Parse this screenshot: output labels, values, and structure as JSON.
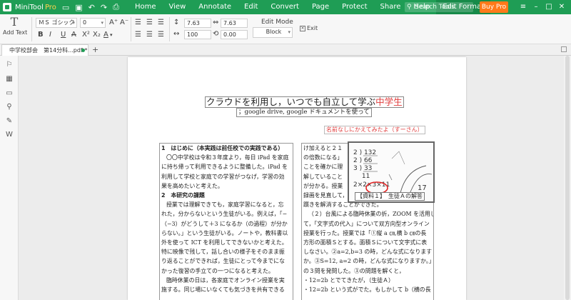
{
  "app": {
    "name": "MiniTool",
    "edition": "Pro",
    "menu": [
      "Home",
      "View",
      "Annotate",
      "Edit",
      "Convert",
      "Page",
      "Protect",
      "Share",
      "Help",
      "Edit Format"
    ],
    "search_placeholder": "Search Tools",
    "buy_label": "Buy Pro",
    "accent_color": "#1f9d55",
    "buy_color": "#ff7a1a"
  },
  "toolbar": {
    "add_text_label": "Add Text",
    "add_text_icon": "T",
    "font_family": "ＭＳ ゴシック",
    "font_size": "0",
    "style_buttons": [
      "B",
      "I",
      "U",
      "A",
      "X²",
      "X₂",
      "A"
    ],
    "line_spacing": "7.63",
    "char_spacing": "7.63",
    "scale": "100",
    "rotation": "0.00",
    "edit_mode_label": "Edit Mode",
    "edit_mode_value": "Block",
    "exit_label": "Exit"
  },
  "tabs": {
    "doc_tab_label": "中学校部会　第14分科...pdf *",
    "add_tab": "+"
  },
  "document": {
    "title_main": "クラウドを利用し，いつでも自立して学ぶ",
    "title_highlight": "中学生",
    "subtitle": "；google drive, google ドキュメントを使って",
    "author": "名前なしにかえてみたよ（すーさん）",
    "left_column": [
      {
        "t": "1　はじめに（本実践は前任校での実践である）",
        "h": true
      },
      {
        "t": "〇〇中学校は令和３年度より，毎日 iPad を家庭",
        "ind": true
      },
      {
        "t": "に持ち帰って利用できるように整備した。iPad を"
      },
      {
        "t": "利用して学校と家庭での学習がつなげ，学習の効"
      },
      {
        "t": "果を高めたいと考えた。"
      },
      {
        "t": "2　本研究の課題",
        "h": true
      },
      {
        "t": "授業では理解できても，家庭学習になると，忘",
        "ind": true
      },
      {
        "t": "れた，分からないという生徒がいる。例えば，「−"
      },
      {
        "t": "（−3）がどうして＋3 になるか（の過程）が分か"
      },
      {
        "t": "らない。」という生徒がいる。ノートや，教科書以"
      },
      {
        "t": "外を使って ICT を利用してできないかと考えた。"
      },
      {
        "t": "特に映像で残して，話し合いの様子をそのまま振"
      },
      {
        "t": "り返ることができれば，生徒にとって今までにな"
      },
      {
        "t": "かった復習の手立ての一つになると考えた。"
      },
      {
        "t": "臨時休業の日は，各家庭でオンライン授業を実",
        "ind": true
      },
      {
        "t": "施する。同じ場にいなくても気づきを共有できる"
      }
    ],
    "right_column": [
      {
        "t": "け加えると２１"
      },
      {
        "t": "の倍数になる」"
      },
      {
        "t": "ことを確かに理"
      },
      {
        "t": "解していること"
      },
      {
        "t": "が分かる。授業"
      },
      {
        "t": "録画を見直して，"
      },
      {
        "t": "躓きを解消することができた。"
      },
      {
        "t": "（２）台風による臨時休業の折，ZOOM を活用し",
        "ind": true
      },
      {
        "t": "て，「文字式の代入」について双方向型オンライン"
      },
      {
        "t": "授業を行った。授業では「①縦 a ㎝,横 b ㎝の長"
      },
      {
        "t": "方形の面積Ｓとする。面積Ｓについて文字式に表"
      },
      {
        "t": "しなさい。②a=2,b=3 の時，どんな式になります"
      },
      {
        "t": "か。③S=12, a=2 の時，どんな式になりますか。」"
      },
      {
        "t": "の３問を発問した。③の問題を解くと，"
      },
      {
        "t": "・12=2b とでてきたが，（生徒Ａ）"
      },
      {
        "t": "・12=2b という式がでた。もしかして b（横の長"
      }
    ],
    "figure_caption": "【資料１】　生徒Ａの解答",
    "figure_handwriting": [
      "2 ) 132",
      "2 ) 66",
      "3 ) 33",
      "　 11",
      "2×2×3×11",
      "17"
    ]
  }
}
